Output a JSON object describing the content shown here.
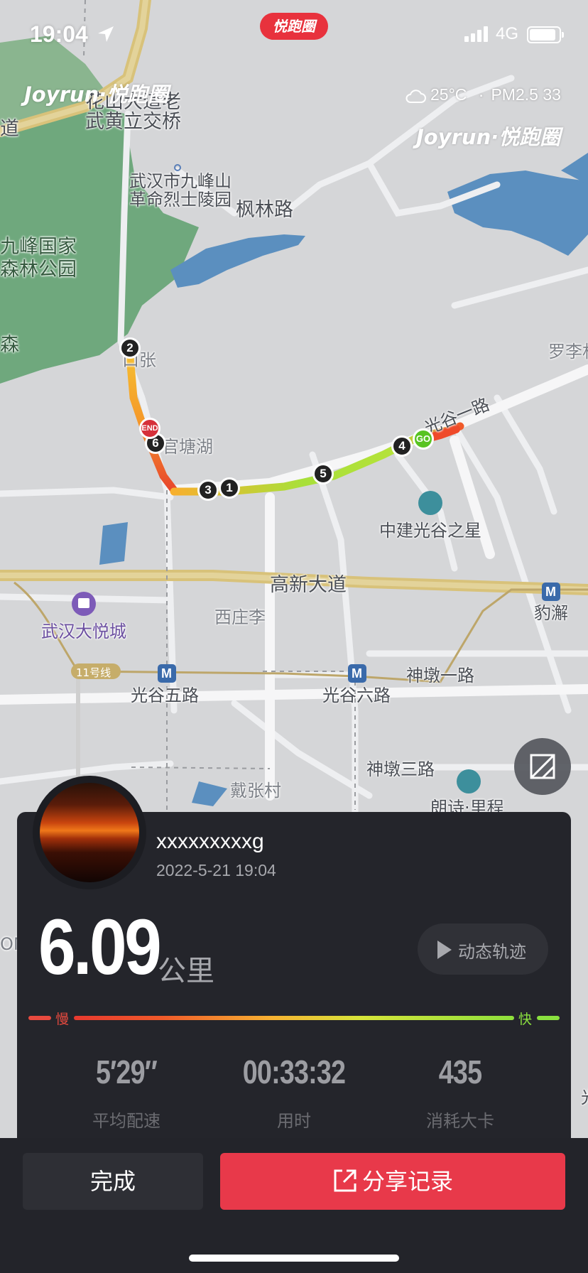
{
  "status_bar": {
    "time": "19:04",
    "network": "4G"
  },
  "app_badge": "悦跑圈",
  "brand_watermark": "Joyrun·悦跑圈",
  "weather": {
    "icon": "cloud-icon",
    "temperature": "25°C",
    "separator": "·",
    "air_quality": "PM2.5 33"
  },
  "map": {
    "labels": {
      "huashan_bridge": "花山大道老",
      "wuhuang_bridge": "武黄立交桥",
      "road_left": "道",
      "jiufeng_cemetery_1": "武汉市九峰山",
      "jiufeng_cemetery_2": "革命烈士陵园",
      "fenglin_road": "枫林路",
      "jiufeng_park_1": "九峰国家",
      "jiufeng_park_2": "森林公园",
      "forest": "森",
      "luoli": "罗李村",
      "zhangjiakou": "口张",
      "guantanghu": "官塘湖",
      "guanggu_yi_road": "光谷一路",
      "zhongjian_star": "中建光谷之星",
      "gaoxin_avenue": "高新大道",
      "baoxie": "豹澥",
      "xizhuangli": "西庄李",
      "wuhan_joy_city": "武汉大悦城",
      "line11": "11号线",
      "shendun_yi_road": "神墩一路",
      "guanggu_5_road": "光谷五路",
      "guanggu_6_road": "光谷六路",
      "shendun_3_road": "神墩三路",
      "daizhang_village": "戴张村",
      "langshi": "朗诗·里程",
      "om": "OM",
      "guang_edge": "光"
    },
    "route_markers": [
      "1",
      "2",
      "3",
      "4",
      "5",
      "6"
    ],
    "start_marker": "GO",
    "end_marker": "END"
  },
  "profile": {
    "username": "xxxxxxxxxg",
    "datetime": "2022-5-21 19:04"
  },
  "run": {
    "distance": "6.09",
    "distance_unit": "公里",
    "replay_label": "动态轨迹"
  },
  "pace_legend": {
    "slow": "慢",
    "fast": "快"
  },
  "stats": [
    {
      "value": "5′29″",
      "label": "平均配速"
    },
    {
      "value": "00:33:32",
      "label": "用时"
    },
    {
      "value": "435",
      "label": "消耗大卡"
    }
  ],
  "actions": {
    "done": "完成",
    "share": "分享记录"
  },
  "colors": {
    "accent": "#e8394a",
    "pace_slow": "#e8392f",
    "pace_fast": "#8ee03c",
    "go": "#58c322",
    "end": "#d6303a"
  }
}
